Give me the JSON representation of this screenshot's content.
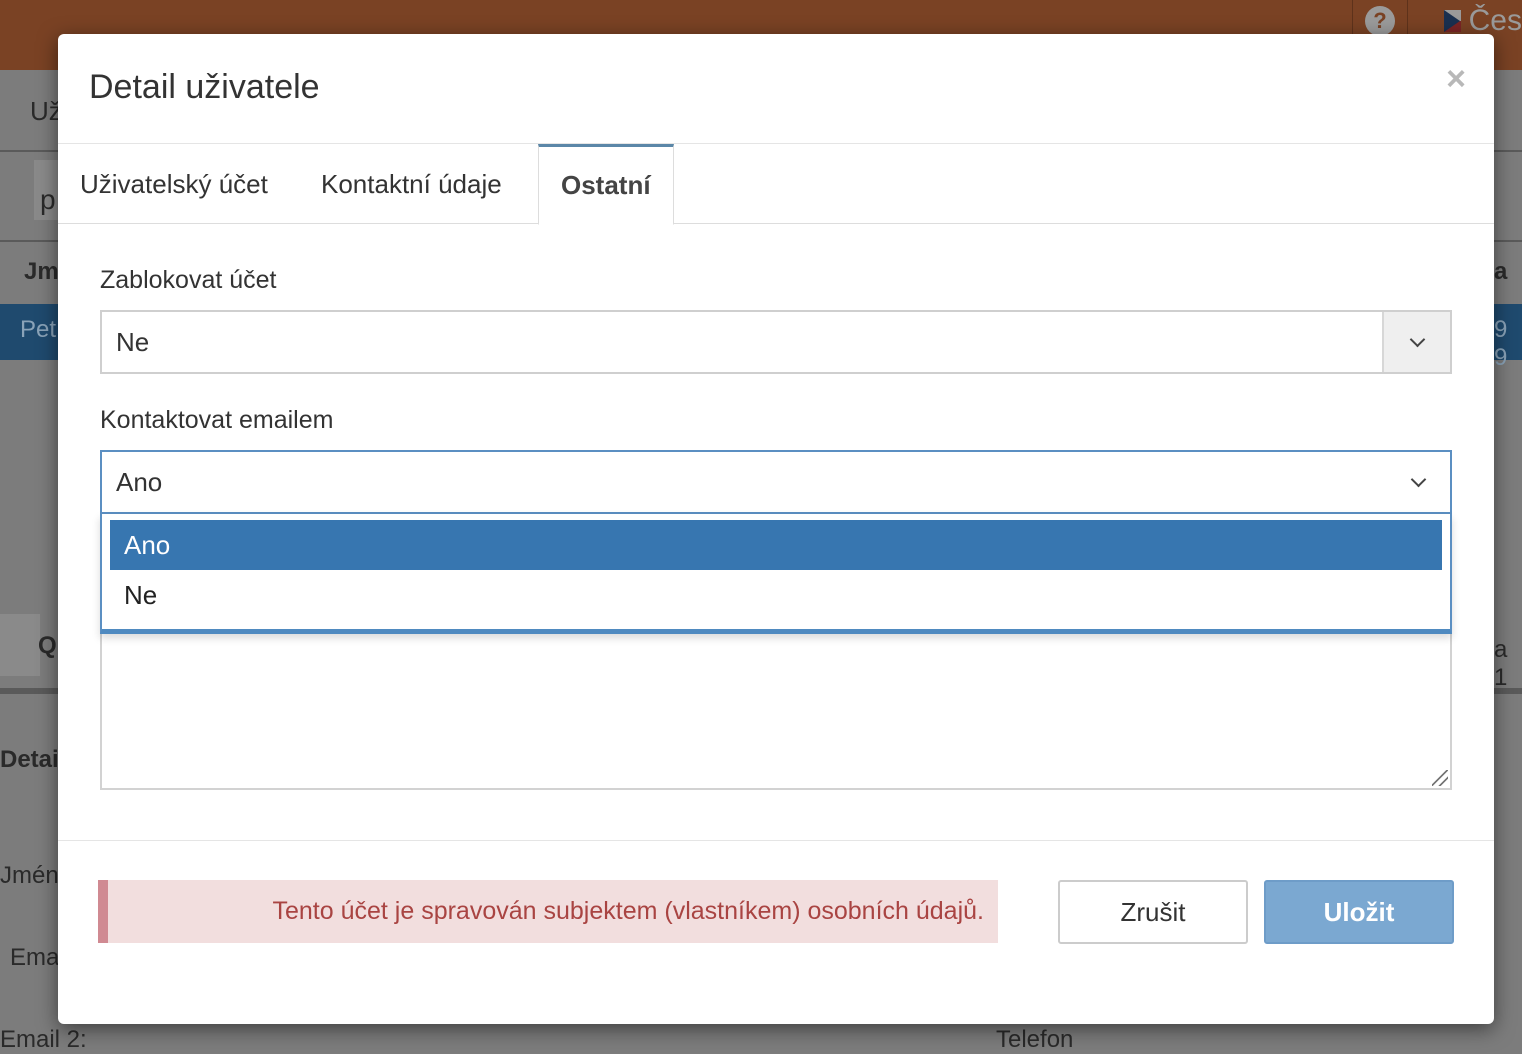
{
  "background": {
    "lang_label": "Čes",
    "help_symbol": "?",
    "fragments": {
      "breadcrumb": "Už",
      "search_text": "p",
      "col_header": "Jm",
      "col_header_right": "a",
      "row_name": "Pet",
      "row_right": "9 9",
      "pager_btn": "Q",
      "pager_right": "a 1",
      "detail_title": "Detai",
      "label_name": "Jmén",
      "label_email": "Ema",
      "label_email2": "Email 2:",
      "label_phone": "Telefon"
    }
  },
  "modal": {
    "title": "Detail uživatele",
    "close_symbol": "×",
    "tabs": [
      {
        "label": "Uživatelský účet"
      },
      {
        "label": "Kontaktní údaje"
      },
      {
        "label": "Ostatní"
      }
    ],
    "active_tab": "Ostatní",
    "fields": {
      "block_account": {
        "label": "Zablokovat účet",
        "value": "Ne"
      },
      "contact_email": {
        "label": "Kontaktovat emailem",
        "value": "Ano"
      }
    },
    "dropdown_options": [
      {
        "label": "Ano",
        "selected": true
      },
      {
        "label": "Ne",
        "selected": false
      }
    ],
    "alert_text": "Tento účet je spravován subjektem (vlastníkem) osobních údajů.",
    "buttons": {
      "cancel": "Zrušit",
      "save": "Uložit"
    }
  },
  "colors": {
    "topbar": "#7a4224",
    "accent": "#3776b0",
    "save_button": "#7ba8d1",
    "alert_bg": "#f2dede",
    "alert_text": "#a94442"
  }
}
